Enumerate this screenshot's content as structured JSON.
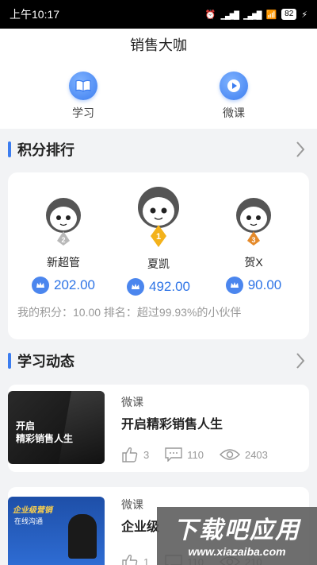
{
  "status_bar": {
    "time": "上午10:17",
    "battery": "82"
  },
  "header": {
    "title": "销售大咖"
  },
  "nav_tabs": [
    {
      "label": "学习"
    },
    {
      "label": "微课"
    }
  ],
  "ranking": {
    "title": "积分排行",
    "entries": [
      {
        "rank": "2",
        "name": "新超管",
        "score": "202.00"
      },
      {
        "rank": "1",
        "name": "夏凯",
        "score": "492.00"
      },
      {
        "rank": "3",
        "name": "贺X",
        "score": "90.00"
      }
    ],
    "my_score": "我的积分：10.00 排名：超过99.93%的小伙伴"
  },
  "feed": {
    "title": "学习动态",
    "items": [
      {
        "type": "微课",
        "title": "开启精彩销售人生",
        "thumb_text": [
          "开启",
          "精彩销售人生"
        ],
        "likes": "3",
        "comments": "110",
        "views": "2403"
      },
      {
        "type": "微课",
        "title": "企业级",
        "thumb_text": [
          "企业级营销",
          "在线沟通"
        ],
        "likes": "1",
        "comments": "110",
        "views": "210"
      }
    ]
  },
  "watermark": {
    "text": "下载吧应用",
    "url": "www.xiazaiba.com"
  },
  "colors": {
    "accent": "#3c7df0",
    "score": "#2e74e6",
    "gold": "#f3b21b",
    "silver": "#b8b8b8",
    "bronze": "#e58a2a"
  }
}
